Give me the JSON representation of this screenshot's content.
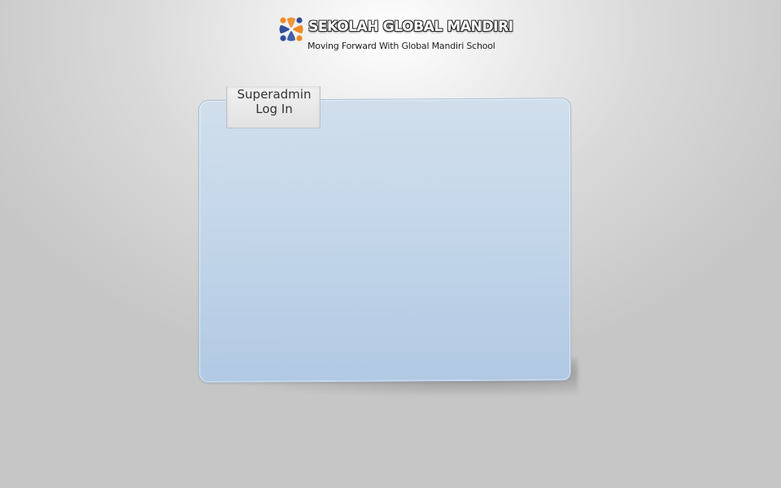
{
  "brand": {
    "title": "SEKOLAH GLOBAL MANDIRI",
    "tagline": "Moving Forward With Global Mandiri School",
    "logo_icon": "school-logo-icon",
    "colors": {
      "orange": "#f08a24",
      "blue": "#2f4e9c"
    }
  },
  "login_panel": {
    "tab_line1": "Superadmin",
    "tab_line2": "Log In",
    "colors": {
      "panel_top": "#d1dfec",
      "panel_bottom": "#b1c9e3",
      "tab": "#e6e6e6"
    }
  }
}
